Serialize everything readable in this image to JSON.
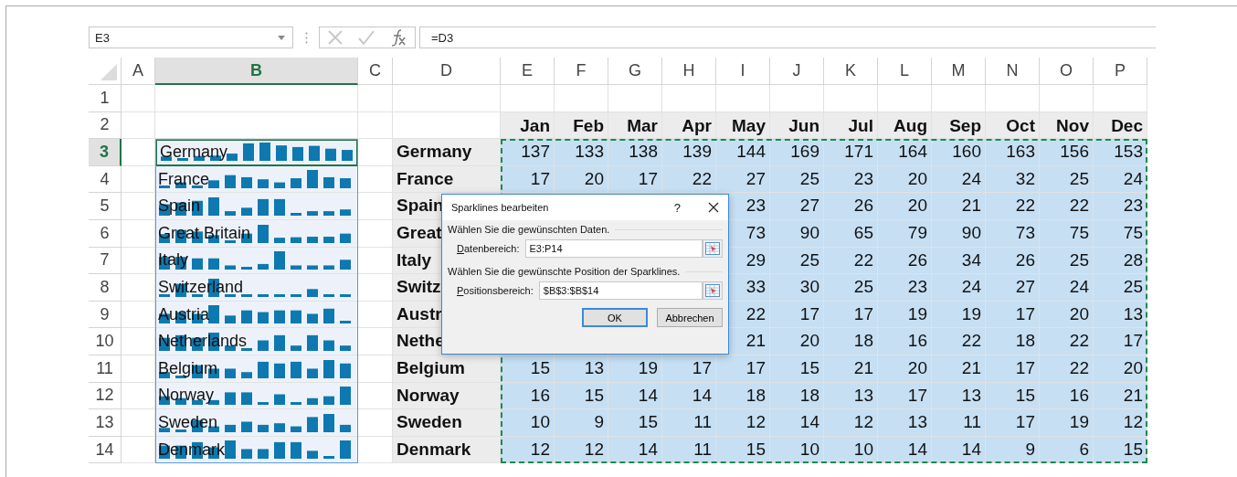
{
  "name_box": {
    "value": "E3"
  },
  "formula_bar": {
    "value": "=D3"
  },
  "column_headers": [
    {
      "label": "A",
      "selected": false
    },
    {
      "label": "B",
      "selected": true
    },
    {
      "label": "C",
      "selected": false
    },
    {
      "label": "D",
      "selected": false
    },
    {
      "label": "E",
      "selected": false
    },
    {
      "label": "F",
      "selected": false
    },
    {
      "label": "G",
      "selected": false
    },
    {
      "label": "H",
      "selected": false
    },
    {
      "label": "I",
      "selected": false
    },
    {
      "label": "J",
      "selected": false
    },
    {
      "label": "K",
      "selected": false
    },
    {
      "label": "L",
      "selected": false
    },
    {
      "label": "M",
      "selected": false
    },
    {
      "label": "N",
      "selected": false
    },
    {
      "label": "O",
      "selected": false
    },
    {
      "label": "P",
      "selected": false
    }
  ],
  "header_rows": [
    {
      "number": "1",
      "selected": false,
      "months": []
    },
    {
      "number": "2",
      "selected": false,
      "months": [
        "Jan",
        "Feb",
        "Mar",
        "Apr",
        "May",
        "Jun",
        "Jul",
        "Aug",
        "Sep",
        "Oct",
        "Nov",
        "Dec"
      ]
    }
  ],
  "rows": [
    {
      "number": "3",
      "selected": true,
      "sparkline": {
        "label": "Germany",
        "active": true
      },
      "country": "Germany",
      "values": [
        "137",
        "133",
        "138",
        "139",
        "144",
        "169",
        "171",
        "164",
        "160",
        "163",
        "156",
        "153"
      ]
    },
    {
      "number": "4",
      "selected": false,
      "sparkline": {
        "label": "France",
        "active": false
      },
      "country": "France",
      "values": [
        "17",
        "20",
        "17",
        "22",
        "27",
        "25",
        "23",
        "20",
        "24",
        "32",
        "25",
        "24"
      ]
    },
    {
      "number": "5",
      "selected": false,
      "sparkline": {
        "label": "Spain",
        "active": false
      },
      "country": "Spain",
      "values": [
        "23",
        "27",
        "26",
        "20",
        "21",
        "22",
        "22",
        "23"
      ]
    },
    {
      "number": "6",
      "selected": false,
      "sparkline": {
        "label": "Great Britain",
        "active": false
      },
      "country": "Great",
      "values": [
        "73",
        "90",
        "65",
        "79",
        "90",
        "73",
        "75",
        "75"
      ]
    },
    {
      "number": "7",
      "selected": false,
      "sparkline": {
        "label": "Italy",
        "active": false
      },
      "country": "Italy",
      "values": [
        "29",
        "25",
        "22",
        "26",
        "34",
        "26",
        "25",
        "28"
      ]
    },
    {
      "number": "8",
      "selected": false,
      "sparkline": {
        "label": "Switzerland",
        "active": false
      },
      "country": "Switz",
      "values": [
        "33",
        "30",
        "25",
        "23",
        "24",
        "27",
        "24",
        "25"
      ]
    },
    {
      "number": "9",
      "selected": false,
      "sparkline": {
        "label": "Austria",
        "active": false
      },
      "country": "Austr",
      "values": [
        "22",
        "17",
        "17",
        "19",
        "19",
        "17",
        "20",
        "13"
      ]
    },
    {
      "number": "10",
      "selected": false,
      "sparkline": {
        "label": "Netherlands",
        "active": false
      },
      "country": "Nethe",
      "values": [
        "21",
        "20",
        "18",
        "16",
        "22",
        "18",
        "22",
        "17"
      ]
    },
    {
      "number": "11",
      "selected": false,
      "sparkline": {
        "label": "Belgium",
        "active": false
      },
      "country": "Belgium",
      "values": [
        "15",
        "13",
        "19",
        "17",
        "17",
        "15",
        "21",
        "20",
        "21",
        "17",
        "22",
        "20"
      ]
    },
    {
      "number": "12",
      "selected": false,
      "sparkline": {
        "label": "Norway",
        "active": false
      },
      "country": "Norway",
      "values": [
        "16",
        "15",
        "14",
        "14",
        "18",
        "18",
        "13",
        "17",
        "13",
        "15",
        "16",
        "21"
      ]
    },
    {
      "number": "13",
      "selected": false,
      "sparkline": {
        "label": "Sweden",
        "active": false
      },
      "country": "Sweden",
      "values": [
        "10",
        "9",
        "15",
        "11",
        "12",
        "14",
        "12",
        "13",
        "11",
        "17",
        "19",
        "12"
      ]
    },
    {
      "number": "14",
      "selected": false,
      "sparkline": {
        "label": "Denmark",
        "active": false
      },
      "country": "Denmark",
      "values": [
        "12",
        "12",
        "14",
        "11",
        "15",
        "10",
        "10",
        "14",
        "14",
        "9",
        "6",
        "15"
      ]
    }
  ],
  "dialog": {
    "title": "Sparklines bearbeiten",
    "help": "?",
    "sections": [
      {
        "heading": "Wählen Sie die gewünschten Daten.",
        "label": "Datenbereich:",
        "value": "E3:P14"
      },
      {
        "heading": "Wählen Sie die gewünschte Position der Sparklines.",
        "label": "Positionsbereich:",
        "value": "$B$3:$B$14"
      }
    ],
    "buttons": [
      {
        "label": "OK",
        "default": true
      },
      {
        "label": "Abbrechen",
        "default": false
      }
    ]
  }
}
